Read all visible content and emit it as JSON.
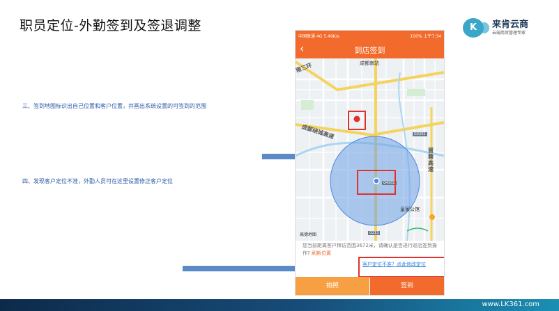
{
  "slide": {
    "title": "职员定位-外勤签到及签退调整",
    "note1": "三、签到地图标识出自己位置和客户位置，并画出系统设置的可签到的范围",
    "note2": "四、发现客户定位不准，外勤人员可在这里设置修正客户定位"
  },
  "logo": {
    "mark": "K",
    "name": "来肯云商",
    "tagline": "云端商贸管理专家"
  },
  "phone": {
    "status_left": "中国联通 4G  5.49K/s",
    "status_right": "100%  上午7:34",
    "nav_title": "到店签到",
    "back_icon": "‹",
    "map_labels": {
      "station": "成都南站",
      "road_west": "成都绕城高速",
      "road_east": "晋蓉高速",
      "district": "皇家公馆",
      "ring": "南三环"
    },
    "road_tags": [
      "G4202",
      "G4202",
      "G213"
    ],
    "map_provider": "高德地图",
    "info_text": "您当前距离客户拜访范围3672米，请确认是否进行巡店签到操作?",
    "refresh_label": "刷新位置",
    "fix_location_link": "客户定位不准？点此修改定位",
    "button_photo": "拍照",
    "button_sign": "签到"
  },
  "footer": {
    "url": "www.LK361.com"
  },
  "colors": {
    "accent": "#f26b2c",
    "photo_button": "#f7a043",
    "circle": "#6fa0e6",
    "marker": "#e0322b",
    "arrow": "#5b8bc6"
  }
}
